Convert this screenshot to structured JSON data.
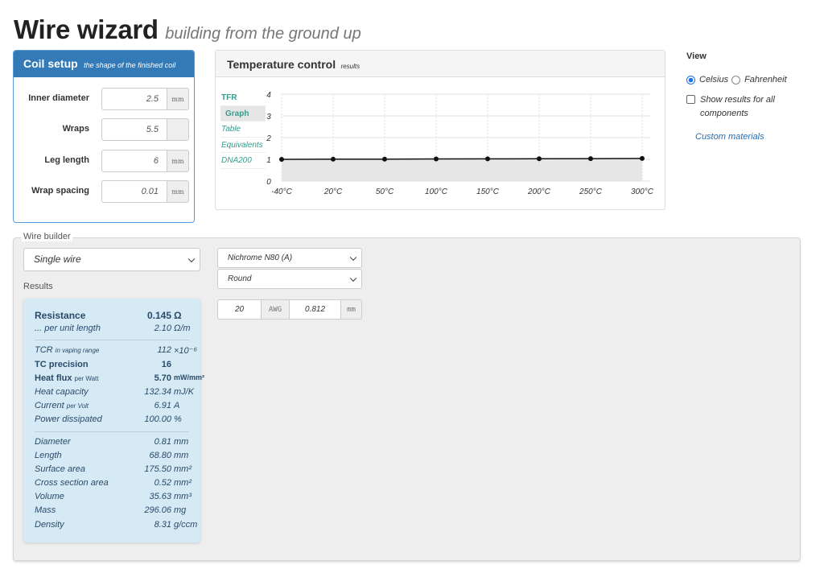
{
  "header": {
    "title": "Wire wizard",
    "subtitle": "building from the ground up"
  },
  "coil_setup": {
    "title": "Coil setup",
    "subtitle": "the shape of the finished coil",
    "fields": [
      {
        "label": "Inner diameter",
        "value": "2.5",
        "unit": "mm"
      },
      {
        "label": "Wraps",
        "value": "5.5",
        "unit": ""
      },
      {
        "label": "Leg length",
        "value": "6",
        "unit": "mm"
      },
      {
        "label": "Wrap spacing",
        "value": "0.01",
        "unit": "mm"
      }
    ]
  },
  "temperature": {
    "title": "Temperature control",
    "subtitle": "results",
    "tabs": [
      "TFR",
      "Graph",
      "Table",
      "Equivalents",
      "DNA200"
    ],
    "active_tab": "Graph"
  },
  "chart_data": {
    "type": "line",
    "categories": [
      "-40°C",
      "20°C",
      "50°C",
      "100°C",
      "150°C",
      "200°C",
      "250°C",
      "300°C"
    ],
    "series": [
      {
        "values": [
          1.0,
          1.007,
          1.011,
          1.017,
          1.022,
          1.028,
          1.034,
          1.04
        ]
      }
    ],
    "yticks": [
      "0",
      "1",
      "2",
      "3",
      "4"
    ],
    "ylim": [
      0,
      4
    ],
    "grid": true,
    "colors": {
      "line": "#111111",
      "fill": "#e6e6e6",
      "grid": "#e2e2e2",
      "label": "#333333"
    }
  },
  "view": {
    "title": "View",
    "radio_celsius": "Celsius",
    "radio_fahrenheit": "Fahrenheit",
    "selected": "Celsius",
    "show_all_label": "Show results for all components",
    "custom_link": "Custom materials"
  },
  "wire_builder": {
    "legend": "Wire builder",
    "wire_type": "Single wire",
    "material": "Nichrome N80 (A)",
    "profile": "Round",
    "gauge": "20",
    "gauge_unit": "AWG",
    "diameter": "0.812",
    "diameter_unit": "mm",
    "results_title": "Results"
  },
  "results": {
    "group1": [
      {
        "key": "Resistance",
        "value": "0.145",
        "unit": "Ω",
        "bold": true
      },
      {
        "key": "... per unit length",
        "value": "2.10",
        "unit_html": "Ω/m"
      }
    ],
    "group2": [
      {
        "key": "TCR",
        "key_small": "in vaping range",
        "value": "112",
        "unit": "×10⁻⁶"
      },
      {
        "key": "TC precision",
        "value": "16",
        "unit": "",
        "bold": true
      },
      {
        "key": "Heat flux",
        "key_small": "per Watt",
        "value": "5.70",
        "unit": "mW/mm²",
        "bold": true
      },
      {
        "key": "Heat capacity",
        "value": "132.34",
        "unit": "mJ/K"
      },
      {
        "key": "Current",
        "key_small": "per Volt",
        "value": "6.91",
        "unit": "A"
      },
      {
        "key": "Power dissipated",
        "value": "100.00",
        "unit": "%"
      }
    ],
    "group3": [
      {
        "key": "Diameter",
        "value": "0.81",
        "unit": "mm"
      },
      {
        "key": "Length",
        "value": "68.80",
        "unit": "mm"
      },
      {
        "key": "Surface area",
        "value": "175.50",
        "unit": "mm²"
      },
      {
        "key": "Cross section area",
        "value": "0.52",
        "unit": "mm²"
      },
      {
        "key": "Volume",
        "value": "35.63",
        "unit": "mm³"
      },
      {
        "key": "Mass",
        "value": "296.06",
        "unit": "mg"
      },
      {
        "key": "Density",
        "value": "8.31",
        "unit": "g/ccm"
      }
    ]
  }
}
